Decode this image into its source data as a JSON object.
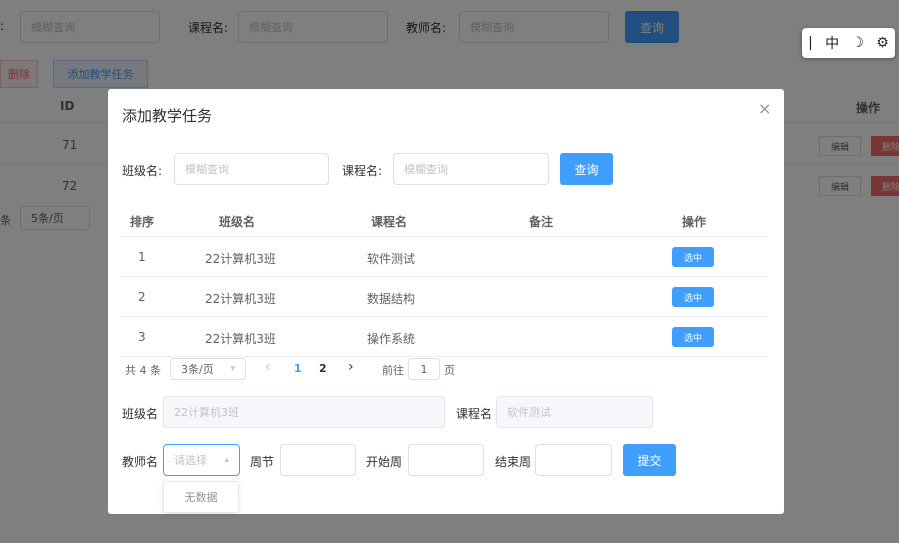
{
  "background": {
    "filter_labels": {
      "cls": ":",
      "course": "课程名:",
      "teacher": "教师名:"
    },
    "placeholder": "模糊查询",
    "query_label": "查询",
    "batch_delete_label": "删除",
    "add_task_label": "添加教学任务",
    "header_id": "ID",
    "header_actions": "操作",
    "rows": [
      {
        "id": "71"
      },
      {
        "id": "72"
      }
    ],
    "edit_label": "编辑",
    "delete_label": "删除",
    "page_size_prefix": "条",
    "page_size": "5条/页"
  },
  "ime_toolbar": {
    "cursor": "|",
    "mode": "中",
    "moon": "☽",
    "gear": "⚙"
  },
  "dialog": {
    "title": "添加教学任务",
    "close": "×",
    "search": {
      "class_label": "班级名:",
      "class_placeholder": "模糊查询",
      "course_label": "课程名:",
      "course_placeholder": "模糊查询",
      "query_label": "查询"
    },
    "table": {
      "headers": [
        "排序",
        "班级名",
        "课程名",
        "备注",
        "操作"
      ],
      "rows": [
        {
          "order": "1",
          "cls": "22计算机3班",
          "course": "软件测试",
          "note": "",
          "action": "选中"
        },
        {
          "order": "2",
          "cls": "22计算机3班",
          "course": "数据结构",
          "note": "",
          "action": "选中"
        },
        {
          "order": "3",
          "cls": "22计算机3班",
          "course": "操作系统",
          "note": "",
          "action": "选中"
        }
      ]
    },
    "pagination": {
      "total": "共 4 条",
      "page_size": "3条/页",
      "prev": "‹",
      "pages": [
        "1",
        "2"
      ],
      "next": "›",
      "goto_label": "前往",
      "goto_value": "1",
      "page_unit": "页"
    },
    "form": {
      "class_label": "班级名",
      "class_value": "22计算机3班",
      "course_label": "课程名",
      "course_value": "软件测试",
      "teacher_label": "教师名",
      "teacher_placeholder": "请选择",
      "week_label": "周节",
      "start_label": "开始周",
      "end_label": "结束周",
      "submit_label": "提交",
      "dropdown_empty": "无数据"
    }
  }
}
